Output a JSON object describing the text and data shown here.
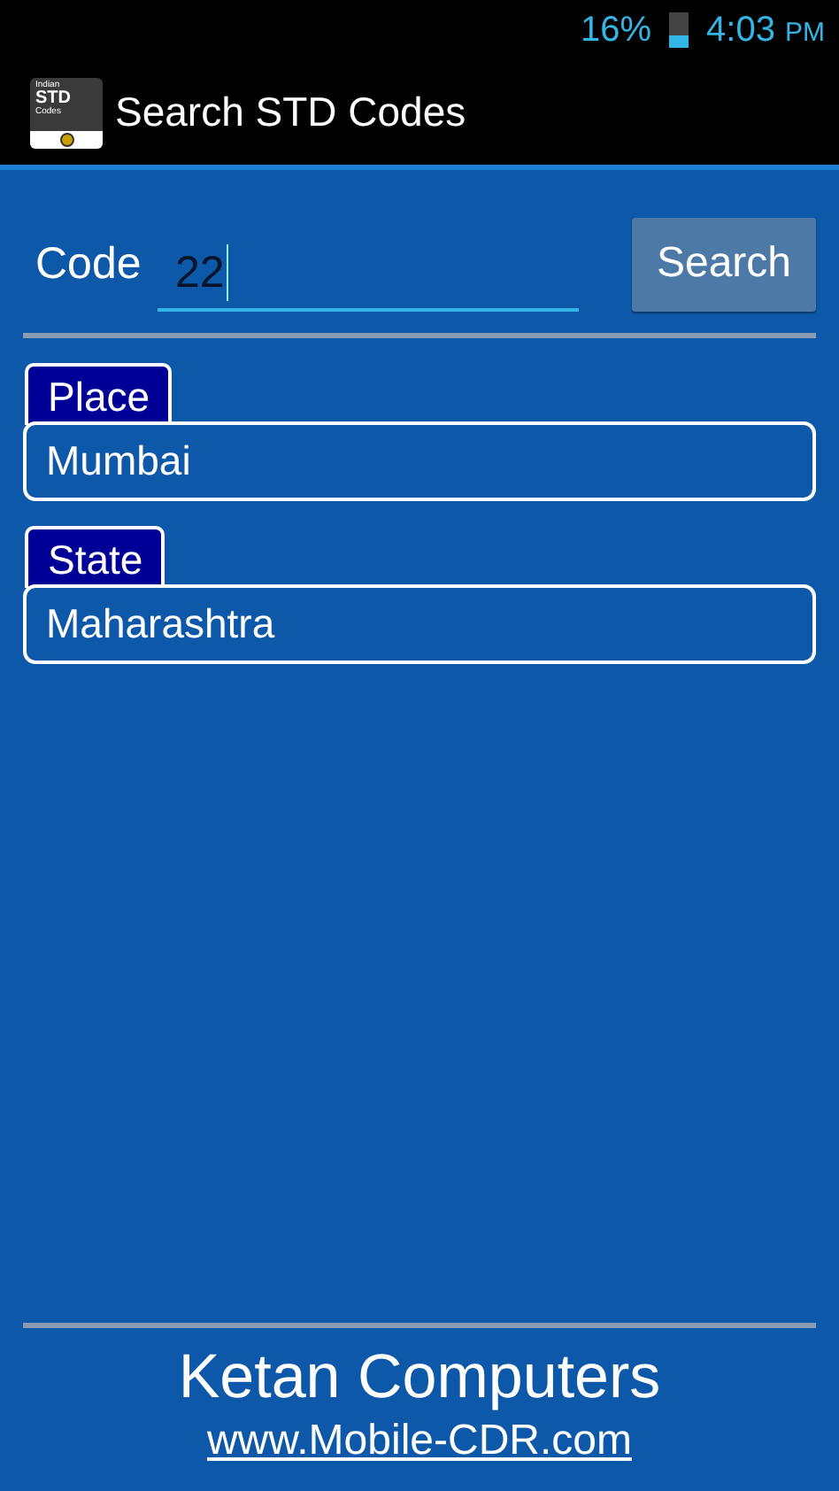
{
  "status_bar": {
    "battery": "16%",
    "time": "4:03",
    "ampm": "PM"
  },
  "action_bar": {
    "icon_lines": [
      "Indian",
      "STD",
      "Codes"
    ],
    "title": "Search STD Codes"
  },
  "search": {
    "label": "Code",
    "value": "22",
    "focused": true,
    "button": "Search"
  },
  "results": [
    {
      "label": "Place",
      "value": "Mumbai"
    },
    {
      "label": "State",
      "value": "Maharashtra"
    }
  ],
  "footer": {
    "company": "Ketan Computers",
    "link": "www.Mobile-CDR.com"
  }
}
